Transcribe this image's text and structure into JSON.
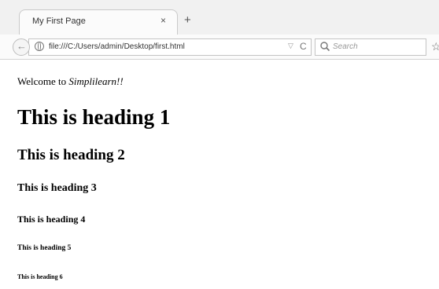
{
  "browser": {
    "tab_title": "My First Page",
    "tab_close": "×",
    "new_tab": "+",
    "back": "←",
    "url": "file:///C:/Users/admin/Desktop/first.html",
    "url_dropdown": "▽",
    "reload": "C",
    "search_placeholder": "Search",
    "bookmark": "☆",
    "icons": [
      "back-arrow-icon",
      "globe-icon",
      "dropdown-icon",
      "reload-icon",
      "search-icon",
      "bookmark-star-icon"
    ]
  },
  "page": {
    "welcome_prefix": "Welcome to ",
    "welcome_emphasis": "Simplilearn!!",
    "headings": [
      "This is heading 1",
      "This is heading 2",
      "This is heading 3",
      "This is heading 4",
      "This is heading 5",
      "This is heading 6"
    ]
  }
}
